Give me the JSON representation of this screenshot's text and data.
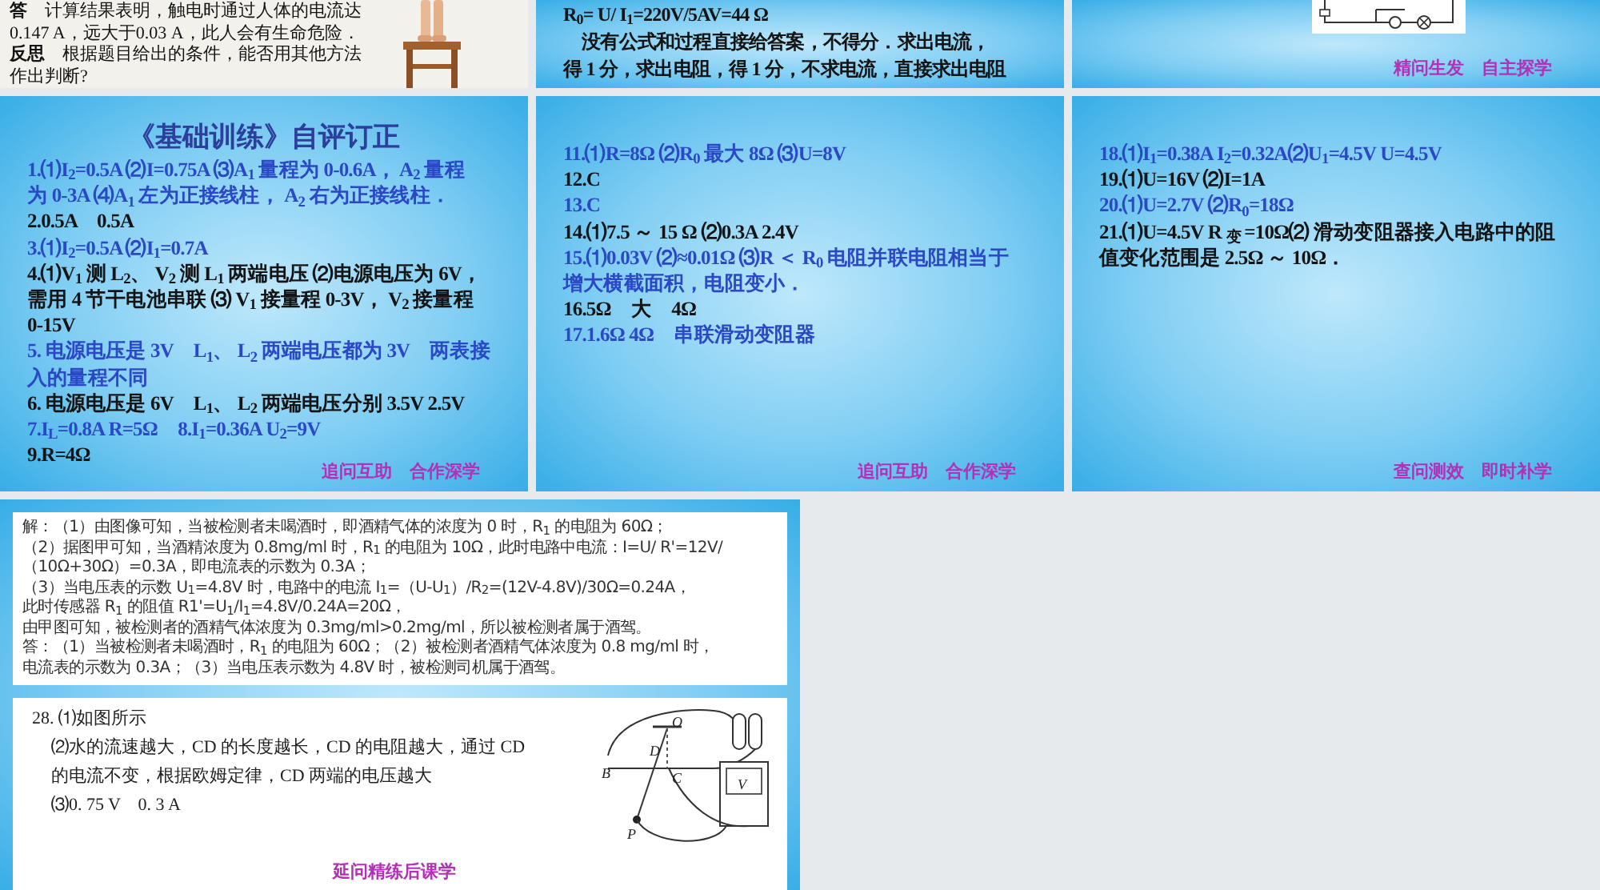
{
  "rows": [
    {
      "slides": [
        {
          "kind": "handout",
          "lines": [
            {
              "text": "**答**　计算结果表明，触电时通过人体的电流达",
              "color": "#141414"
            },
            {
              "text": "0.147 A，远大于0.03 A，此人会有生命危险．",
              "color": "#141414"
            },
            {
              "text": "**反思**　根据题目给出的条件，能否用其他方法",
              "color": "#141414"
            },
            {
              "text": "作出判断?",
              "color": "#141414"
            }
          ]
        },
        {
          "kind": "text",
          "lines": [
            {
              "text": "R$_{0}$= U/ I$_{1}$=220V/5AV=44 Ω",
              "color": "#141414"
            },
            {
              "text": "　没有公式和过程直接给答案，不得分．求出电流，",
              "color": "#141414"
            },
            {
              "text": "得 1 分，求出电阻，得 1 分，不求电流，直接求出电阻",
              "color": "#141414"
            }
          ]
        },
        {
          "kind": "circuit",
          "footer": "精问生发　自主探学"
        }
      ]
    },
    {
      "slides": [
        {
          "kind": "text",
          "title": "《基础训练》自评订正",
          "lines": [
            {
              "text": "1.⑴I$_{2}$=0.5A ⑵I=0.75A ⑶A$_{1}$ 量程为 0-0.6A， A$_{2}$ 量程",
              "color": "#2b48c6"
            },
            {
              "text": "为 0-3A ⑷A$_{1}$ 左为正接线柱， A$_{2}$ 右为正接线柱．",
              "color": "#2b48c6"
            },
            {
              "text": "2.0.5A　0.5A",
              "color": "#141414"
            },
            {
              "text": "3.⑴I$_{2}$=0.5A ⑵I$_{1}$=0.7A",
              "color": "#2b48c6"
            },
            {
              "text": "4.⑴V$_{1}$ 测 L$_{2}$、 V$_{2}$ 测 L$_{1}$ 两端电压 ⑵电源电压为 6V，",
              "color": "#141414"
            },
            {
              "text": "需用 4 节干电池串联 ⑶ V$_{1}$ 接量程 0-3V， V$_{2}$ 接量程",
              "color": "#141414"
            },
            {
              "text": "0-15V",
              "color": "#141414"
            },
            {
              "text": "5. 电源电压是 3V　L$_{1}$、 L$_{2}$ 两端电压都为 3V　两表接",
              "color": "#2b48c6"
            },
            {
              "text": "入的量程不同",
              "color": "#2b48c6"
            },
            {
              "text": "6. 电源电压是 6V　L$_{1}$、 L$_{2}$ 两端电压分别 3.5V 2.5V",
              "color": "#141414"
            },
            {
              "text": "7.I$_{L}$=0.8A R=5Ω　8.I$_{1}$=0.36A U$_{2}$=9V",
              "color": "#2b48c6"
            },
            {
              "text": "9.R=4Ω",
              "color": "#141414"
            }
          ],
          "footer": "追问互助　合作深学"
        },
        {
          "kind": "text",
          "lines": [
            {
              "text": "11.⑴R=8Ω ⑵R$_{0}$ 最大 8Ω ⑶U=8V",
              "color": "#2b48c6"
            },
            {
              "text": "12.C",
              "color": "#141414"
            },
            {
              "text": "13.C",
              "color": "#2b48c6"
            },
            {
              "text": "14.⑴7.5 ～ 15 Ω ⑵0.3A 2.4V",
              "color": "#141414"
            },
            {
              "text": "15.⑴0.03V ⑵≈0.01Ω ⑶R ＜ R$_{0}$ 电阻并联电阻相当于",
              "color": "#2b48c6"
            },
            {
              "text": "增大横截面积，电阻变小．",
              "color": "#2b48c6"
            },
            {
              "text": "16.5Ω　大　4Ω",
              "color": "#141414"
            },
            {
              "text": "17.1.6Ω 4Ω　串联滑动变阻器",
              "color": "#2b48c6"
            }
          ],
          "footer": "追问互助　合作深学"
        },
        {
          "kind": "text",
          "lines": [
            {
              "text": "18.⑴I$_{1}$=0.38A I$_{2}$=0.32A⑵U$_{1}$=4.5V U=4.5V",
              "color": "#2b48c6"
            },
            {
              "text": "19.⑴U=16V ⑵I=1A",
              "color": "#141414"
            },
            {
              "text": "20.⑴U=2.7V ⑵R$_{0}$=18Ω",
              "color": "#2b48c6"
            },
            {
              "text": "21.⑴U=4.5V R $_{变}$ =10Ω⑵ 滑动变阻器接入电路中的阻",
              "color": "#141414"
            },
            {
              "text": "值变化范围是 2.5Ω ～ 10Ω．",
              "color": "#141414"
            }
          ],
          "footer": "查问测效　即时补学"
        }
      ]
    },
    {
      "slides": [
        {
          "kind": "panels",
          "solution_lines": [
            "解：（1）由图像可知，当被检测者未喝酒时，即酒精气体的浓度为 0 时，R$_{1}$ 的电阻为 60Ω；",
            "（2）据图甲可知，当酒精浓度为 0.8mg/ml 时，R$_{1}$ 的电阻为 10Ω，此时电路中电流：I=U/ R'=12V/",
            "（10Ω+30Ω）=0.3A，即电流表的示数为 0.3A；",
            "（3）当电压表的示数 U$_{1}$=4.8V 时，电路中的电流 I$_{1}$=（U-U$_{1}$）/R$_{2}$=(12V-4.8V)/30Ω=0.24A，",
            "此时传感器 R$_{1}$ 的阻值 R1'=U$_{1}$/I$_{1}$=4.8V/0.24A=20Ω，",
            "由甲图可知，被检测者的酒精气体浓度为 0.3mg/ml>0.2mg/ml，所以被检测者属于酒驾。",
            "答：（1）当被检测者未喝酒时，R$_{1}$ 的电阻为 60Ω；（2）被检测者酒精气体浓度为 0.8 mg/ml 时，",
            "电流表的示数为 0.3A；（3）当电压表示数为 4.8V 时，被检测司机属于酒驾。"
          ],
          "problem_lines": [
            "28. ⑴如图所示",
            "⑵水的流速越大，CD 的长度越长，CD 的电阻越大，通过 CD",
            "的电流不变，根据欧姆定律，CD 两端的电压越大",
            "⑶0. 75 V　0. 3 A"
          ],
          "diagram_labels": [
            "B",
            "D",
            "O",
            "C",
            "P",
            "V"
          ],
          "footer": "延问精练后课学"
        }
      ]
    }
  ]
}
